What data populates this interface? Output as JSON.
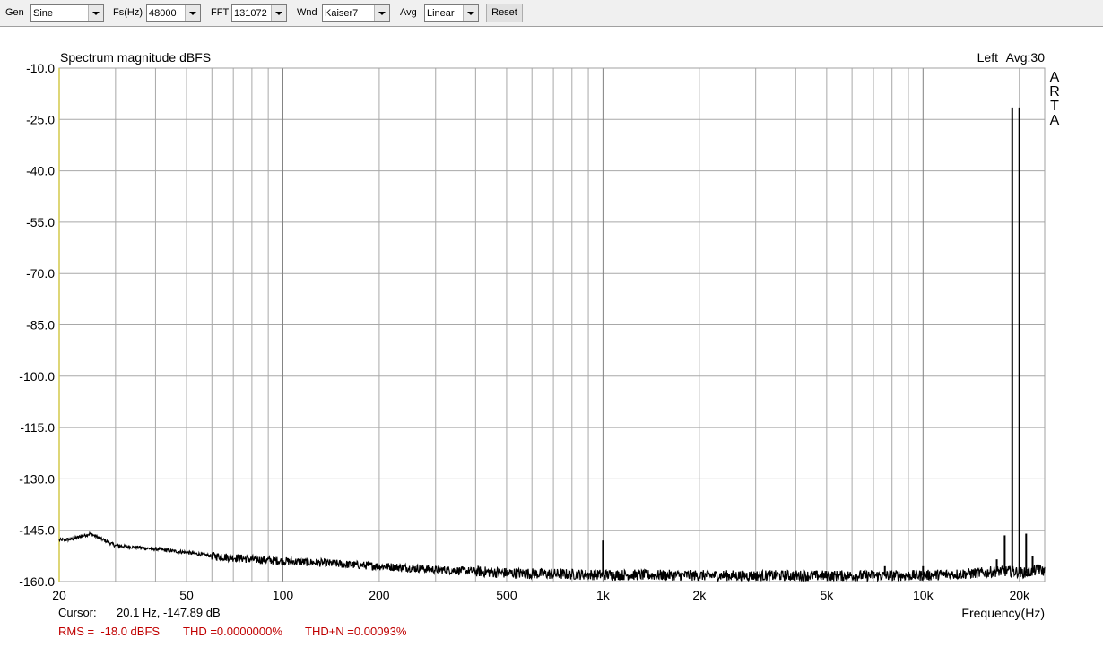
{
  "toolbar": {
    "gen_label": "Gen",
    "gen_value": "Sine",
    "fs_label": "Fs(Hz)",
    "fs_value": "48000",
    "fft_label": "FFT",
    "fft_value": "131072",
    "wnd_label": "Wnd",
    "wnd_value": "Kaiser7",
    "avg_label": "Avg",
    "avg_value": "Linear",
    "reset_label": "Reset"
  },
  "chart_data": {
    "type": "line",
    "title": "Spectrum magnitude dBFS",
    "channel": "Left",
    "avg_info": "Avg:30",
    "watermark": "ARTA",
    "xlabel": "Frequency(Hz)",
    "ylabel": "",
    "xscale": "log",
    "xlim": [
      20,
      24000
    ],
    "ylim": [
      -160,
      -10
    ],
    "xticks": [
      {
        "v": 20,
        "label": "20"
      },
      {
        "v": 50,
        "label": "50"
      },
      {
        "v": 100,
        "label": "100"
      },
      {
        "v": 200,
        "label": "200"
      },
      {
        "v": 500,
        "label": "500"
      },
      {
        "v": 1000,
        "label": "1k"
      },
      {
        "v": 2000,
        "label": "2k"
      },
      {
        "v": 5000,
        "label": "5k"
      },
      {
        "v": 10000,
        "label": "10k"
      },
      {
        "v": 20000,
        "label": "20k"
      }
    ],
    "yticks": [
      {
        "v": -10,
        "label": "-10.0"
      },
      {
        "v": -25,
        "label": "-25.0"
      },
      {
        "v": -40,
        "label": "-40.0"
      },
      {
        "v": -55,
        "label": "-55.0"
      },
      {
        "v": -70,
        "label": "-70.0"
      },
      {
        "v": -85,
        "label": "-85.0"
      },
      {
        "v": -100,
        "label": "-100.0"
      },
      {
        "v": -115,
        "label": "-115.0"
      },
      {
        "v": -130,
        "label": "-130.0"
      },
      {
        "v": -145,
        "label": "-145.0"
      },
      {
        "v": -160,
        "label": "-160.0"
      }
    ],
    "grid": true,
    "noise_floor": [
      [
        20,
        -147.9
      ],
      [
        22,
        -147.6
      ],
      [
        24,
        -146.5
      ],
      [
        25,
        -146.0
      ],
      [
        27,
        -147.5
      ],
      [
        30,
        -149.5
      ],
      [
        35,
        -150.0
      ],
      [
        40,
        -150.5
      ],
      [
        50,
        -151.5
      ],
      [
        60,
        -152.5
      ],
      [
        70,
        -153.0
      ],
      [
        80,
        -153.5
      ],
      [
        100,
        -154.0
      ],
      [
        130,
        -154.5
      ],
      [
        160,
        -155.0
      ],
      [
        200,
        -155.5
      ],
      [
        250,
        -156.0
      ],
      [
        300,
        -156.5
      ],
      [
        400,
        -157.0
      ],
      [
        500,
        -157.5
      ],
      [
        700,
        -157.8
      ],
      [
        1000,
        -158.0
      ],
      [
        2000,
        -158.2
      ],
      [
        5000,
        -158.3
      ],
      [
        10000,
        -158.2
      ],
      [
        15000,
        -157.5
      ],
      [
        17000,
        -157.0
      ],
      [
        19000,
        -157.0
      ],
      [
        21000,
        -157.5
      ],
      [
        23000,
        -156.5
      ],
      [
        24000,
        -157.0
      ]
    ],
    "peaks": [
      {
        "f": 1000,
        "db": -148.0
      },
      {
        "f": 7600,
        "db": -155.5
      },
      {
        "f": 10000,
        "db": -155.5
      },
      {
        "f": 17000,
        "db": -153.5
      },
      {
        "f": 18000,
        "db": -146.5
      },
      {
        "f": 19000,
        "db": -21.5
      },
      {
        "f": 20000,
        "db": -21.5
      },
      {
        "f": 21000,
        "db": -146.0
      },
      {
        "f": 22000,
        "db": -152.5
      },
      {
        "f": 23000,
        "db": -155.0
      }
    ]
  },
  "status": {
    "cursor_label": "Cursor:",
    "cursor_value": "20.1 Hz, -147.89 dB",
    "rms": "RMS =  -18.0 dBFS",
    "thd": "THD =0.0000000%",
    "thdn": "THD+N =0.00093%"
  },
  "colors": {
    "grid": "#a8a8a8",
    "grid_major": "#808080",
    "trace": "#000000",
    "left_axis": "#d4c84a",
    "status_red": "#c00000"
  }
}
